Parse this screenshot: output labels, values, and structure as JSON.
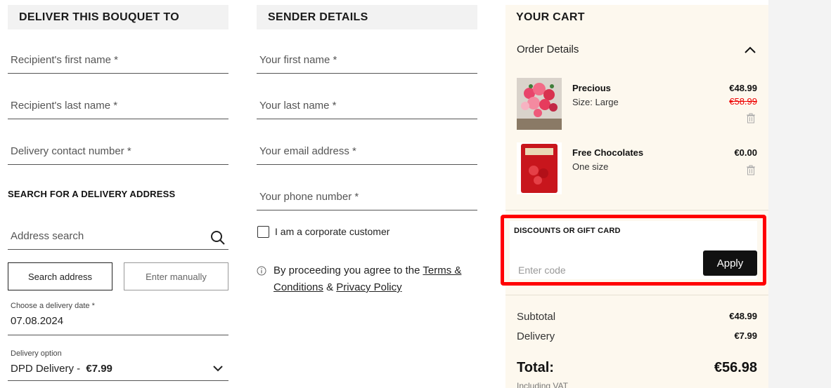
{
  "deliver": {
    "title": "DELIVER THIS BOUQUET TO",
    "first_name_placeholder": "Recipient's first name *",
    "last_name_placeholder": "Recipient's last name *",
    "contact_placeholder": "Delivery contact number *",
    "address_heading": "SEARCH FOR A DELIVERY ADDRESS",
    "address_placeholder": "Address search",
    "search_address_btn": "Search address",
    "enter_manually_btn": "Enter manually",
    "date_label": "Choose a delivery date *",
    "date_value": "07.08.2024",
    "option_label": "Delivery option",
    "option_name": "DPD Delivery -",
    "option_price": "€7.99"
  },
  "sender": {
    "title": "SENDER DETAILS",
    "first_name_placeholder": "Your first name *",
    "last_name_placeholder": "Your last name *",
    "email_placeholder": "Your email address *",
    "phone_placeholder": "Your phone number *",
    "corporate_label": "I am a corporate customer",
    "legal_prefix": "By proceeding you agree to the",
    "terms_link": "Terms & Conditions",
    "legal_and": "&",
    "privacy_link": "Privacy Policy"
  },
  "cart": {
    "title": "YOUR CART",
    "order_details": "Order Details",
    "items": [
      {
        "name": "Precious",
        "size": "Size: Large",
        "price": "€48.99",
        "old_price": "€58.99"
      },
      {
        "name": "Free Chocolates",
        "size": "One size",
        "price": "€0.00"
      }
    ],
    "discount_title": "DISCOUNTS OR GIFT CARD",
    "code_placeholder": "Enter code",
    "apply_label": "Apply",
    "subtotal_label": "Subtotal",
    "subtotal_value": "€48.99",
    "delivery_label": "Delivery",
    "delivery_value": "€7.99",
    "total_label": "Total:",
    "total_value": "€56.98",
    "vat_note": "Including VAT"
  },
  "colors": {
    "highlight": "#ff0000",
    "cart_bg": "#fdf8ee",
    "old_price": "#ee0000"
  }
}
